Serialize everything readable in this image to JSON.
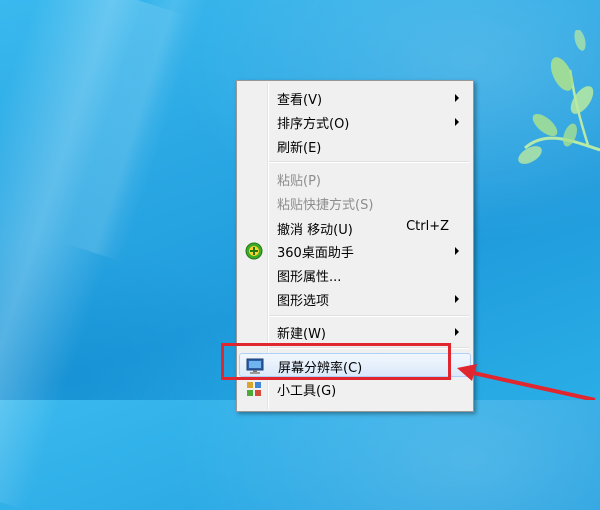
{
  "desktop": {
    "accent_color": "#2aa8e4",
    "highlight_color": "#e0262f"
  },
  "context_menu": {
    "items": [
      {
        "label": "查看(V)",
        "has_submenu": true
      },
      {
        "label": "排序方式(O)",
        "has_submenu": true
      },
      {
        "label": "刷新(E)"
      },
      {
        "label": "粘贴(P)",
        "disabled": true
      },
      {
        "label": "粘贴快捷方式(S)",
        "disabled": true
      },
      {
        "label": "撤消 移动(U)",
        "shortcut": "Ctrl+Z"
      },
      {
        "label": "360桌面助手",
        "icon": "360-icon",
        "has_submenu": true
      },
      {
        "label": "图形属性..."
      },
      {
        "label": "图形选项",
        "has_submenu": true
      },
      {
        "label": "新建(W)",
        "has_submenu": true
      },
      {
        "label": "屏幕分辨率(C)",
        "icon": "monitor-icon",
        "highlighted": true
      },
      {
        "label": "小工具(G)",
        "icon": "gadget-icon"
      }
    ]
  }
}
